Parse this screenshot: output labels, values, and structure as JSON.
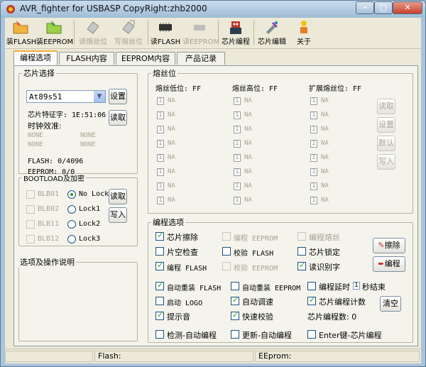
{
  "window": {
    "title": "AVR_fighter for USBASP  CopyRight:zhb2000"
  },
  "toolbar": {
    "buttons": [
      {
        "label": "装FLASH"
      },
      {
        "label": "装EEPROM"
      },
      {
        "label": "读熔丝位"
      },
      {
        "label": "写熔丝位"
      },
      {
        "label": "读FLASH"
      },
      {
        "label": "读EEPROM"
      },
      {
        "label": "芯片编程"
      },
      {
        "label": "芯片编辑"
      },
      {
        "label": "关于"
      }
    ]
  },
  "tabs": [
    {
      "label": "编程选项"
    },
    {
      "label": "FLASH内容"
    },
    {
      "label": "EEPROM内容"
    },
    {
      "label": "产品记录"
    }
  ],
  "chip": {
    "legend": "芯片选择",
    "selected": "At89s51",
    "set_button": "设置",
    "read_button": "读取",
    "signature": "芯片特征字: 1E:51:06",
    "clock_label": "时钟效准:",
    "clock": [
      "NONE",
      "NONE",
      "NONE",
      "NONE"
    ],
    "flash": "FLASH: 0/4096",
    "eeprom": "EEPROM: 0/0"
  },
  "boot": {
    "legend": "BOOTLOAD及加密",
    "bits": [
      "BLB01",
      "BLB02",
      "BLB11",
      "BLB12"
    ],
    "locks": [
      "No Lock",
      "Lock1",
      "Lock2",
      "Lock3"
    ],
    "read_button": "读取",
    "write_button": "写入"
  },
  "notes": {
    "legend": "选项及操作说明"
  },
  "fuse": {
    "legend": "熔丝位",
    "columns": [
      "熔丝低位: FF",
      "熔丝高位: FF",
      "扩展熔丝位: FF"
    ],
    "bit_value": "1",
    "bit_label": "NA",
    "buttons": [
      "读取",
      "设置",
      "默认",
      "写入"
    ]
  },
  "options": {
    "legend": "编程选项",
    "row1": [
      "芯片擦除",
      "编程 EEPROM",
      "编程熔丝"
    ],
    "row2": [
      "片空检查",
      "校验 FLASH",
      "芯片锁定"
    ],
    "row3": [
      "编程 FLASH",
      "校验 EEPROM",
      "读识别字"
    ],
    "row4": [
      "自动重装 FLASH",
      "自动重装 EEPROM"
    ],
    "delay_prefix": "编程延时",
    "delay_value": "1",
    "delay_suffix": "秒结束",
    "row5": [
      "启动 LOGO",
      "自动调速",
      "芯片编程计数"
    ],
    "row6": [
      "提示音",
      "快速校验"
    ],
    "count": "芯片编程数: 0",
    "row7": [
      "检测-自动编程",
      "更新-自动编程",
      "Enter键-芯片编程"
    ],
    "erase_button": "擦除",
    "program_button": "编程",
    "clear_button": "清空"
  },
  "status": {
    "flash": "Flash:",
    "eeprom": "EEprom:"
  }
}
